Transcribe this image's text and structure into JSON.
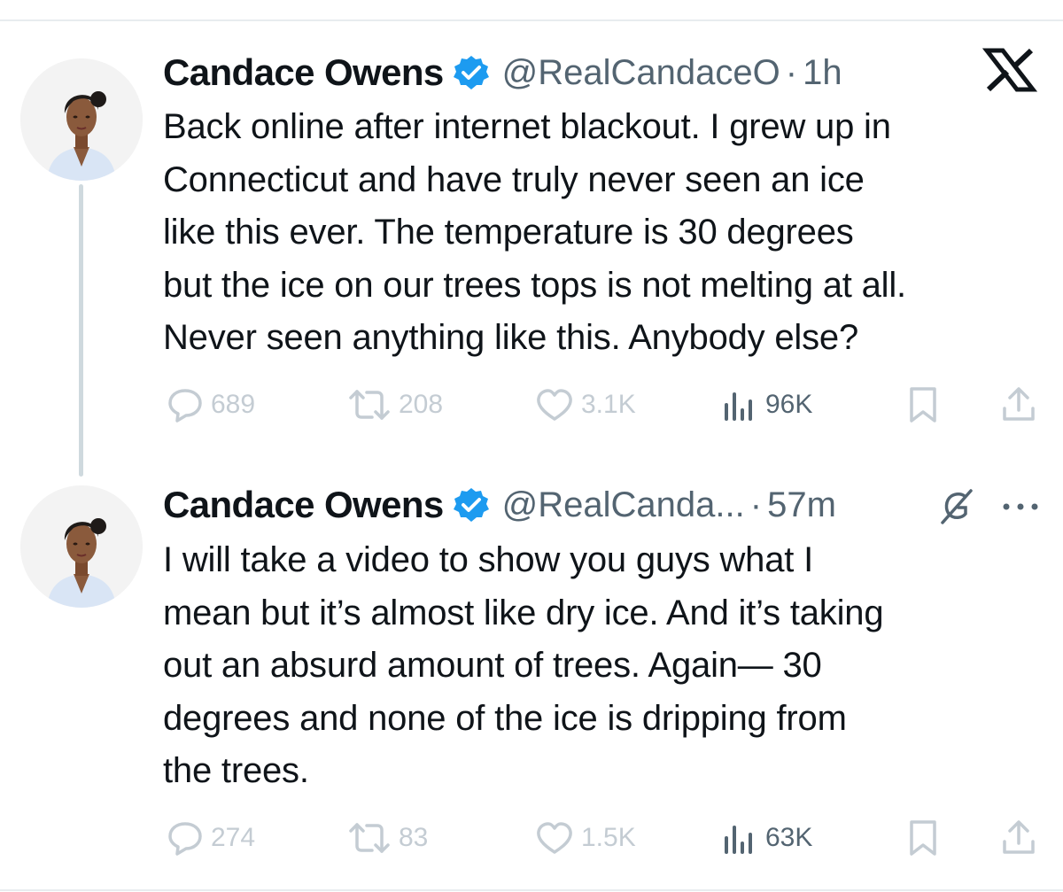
{
  "platform_logo": "x-logo",
  "tweets": [
    {
      "author_name": "Candace Owens",
      "handle": "@RealCandaceO",
      "separator": "·",
      "time": "1h",
      "verified_icon": "verified-badge-icon",
      "text_lines": [
        "Back online after internet blackout. I grew up in",
        "Connecticut and have truly never seen an ice",
        "like this ever. The temperature is 30 degrees",
        "but the ice on our trees tops is not melting at all.",
        "Never seen anything like this. Anybody else?"
      ],
      "replies": "689",
      "reposts": "208",
      "likes": "3.1K",
      "views": "96K"
    },
    {
      "author_name": "Candace Owens",
      "handle": "@RealCanda...",
      "separator": "·",
      "time": "57m",
      "verified_icon": "verified-badge-icon",
      "text_lines": [
        "I will take a video to show you guys what I",
        "mean but it’s almost like dry ice. And it’s taking",
        "out an absurd amount of trees. Again— 30",
        "degrees and none of the ice is dripping from",
        "the trees."
      ],
      "replies": "274",
      "reposts": "83",
      "likes": "1.5K",
      "views": "63K"
    }
  ],
  "icons": [
    "reply-icon",
    "repost-icon",
    "like-icon",
    "views-icon",
    "bookmark-icon",
    "share-icon",
    "grok-icon",
    "more-icon"
  ],
  "colors": {
    "text": "#0f1419",
    "secondary_text": "#536471",
    "faded_action": "#c4ccd3",
    "verified_blue": "#1d9bf0",
    "thread_line": "#cfd9de"
  }
}
